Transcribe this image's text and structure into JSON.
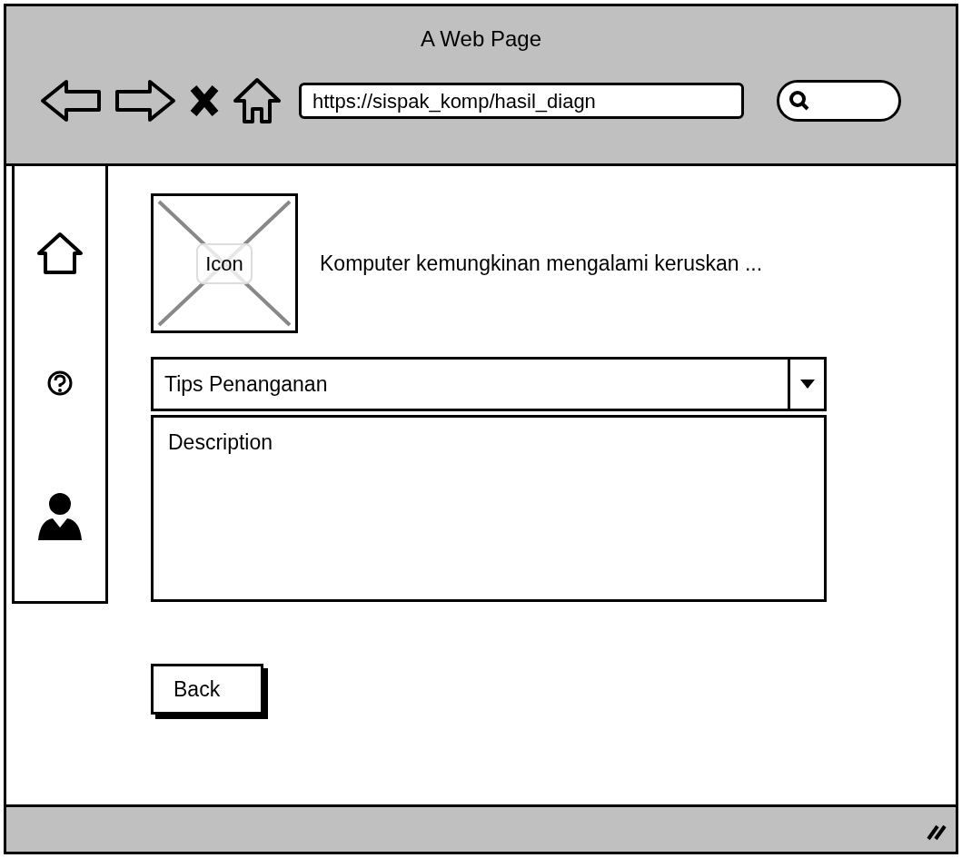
{
  "window": {
    "title": "A Web Page"
  },
  "address_bar": {
    "value": "https://sispak_komp/hasil_diagn"
  },
  "result": {
    "image_label": "Icon",
    "message": "Komputer kemungkinan mengalami keruskan ..."
  },
  "dropdown": {
    "value": "Tips Penanganan"
  },
  "description": {
    "value": "Description"
  },
  "buttons": [
    {
      "label": "Back"
    }
  ]
}
